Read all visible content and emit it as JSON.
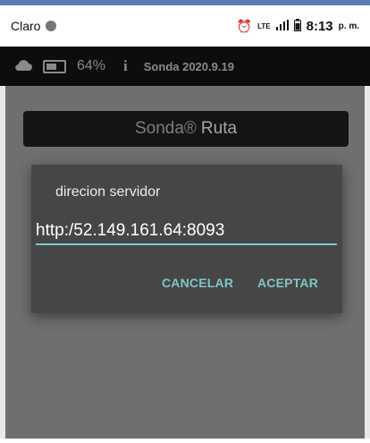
{
  "status_bar": {
    "carrier": "Claro",
    "alarm_icon": "alarm-clock-icon",
    "network_label": "LTE",
    "time": "8:13",
    "ampm": "p. m."
  },
  "app_bar": {
    "cloud_icon": "cloud-icon",
    "battery_icon": "battery-icon",
    "battery_percent": "64%",
    "info_icon": "info-icon",
    "version": "Sonda 2020.9.19"
  },
  "banner": {
    "brand": "Sonda®",
    "product": "Ruta"
  },
  "dialog": {
    "title": "direcion servidor",
    "input_value": "http:/52.149.161.64:8093",
    "cancel_label": "CANCELAR",
    "accept_label": "ACEPTAR"
  },
  "colors": {
    "accent": "#80c6c6",
    "app_bar_bg": "#0d0d0d",
    "dialog_bg": "#464646"
  }
}
